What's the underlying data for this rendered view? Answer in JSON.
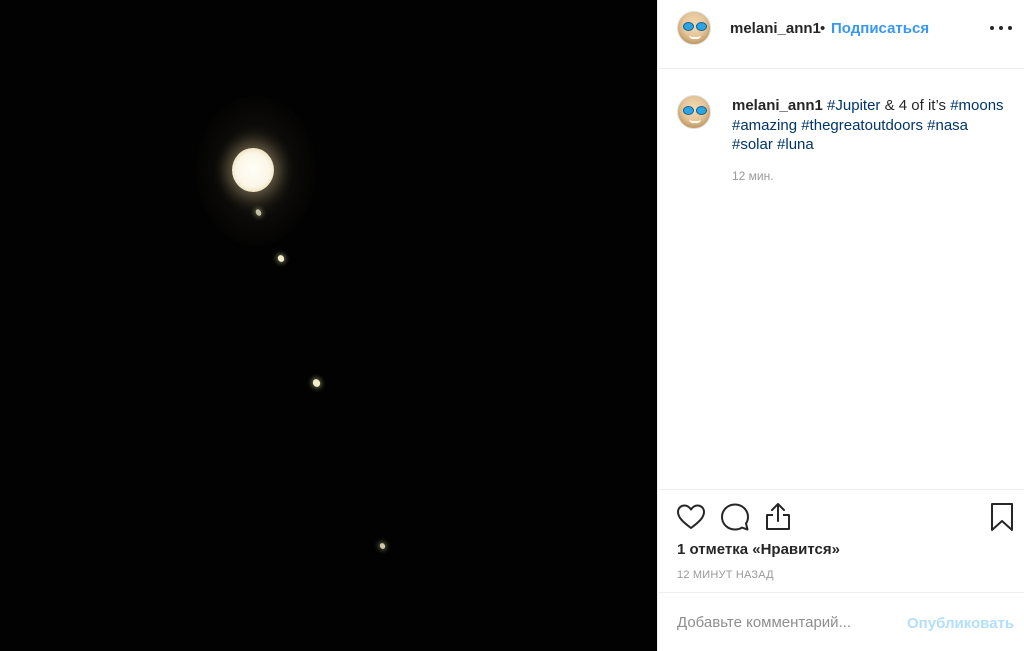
{
  "post": {
    "username": "melani_ann1",
    "separator": "•",
    "follow_label": "Подписаться",
    "more_icon": "more-horizontal-icon"
  },
  "caption": {
    "username": "melani_ann1",
    "text_1": " ",
    "tag_jupiter": "#Jupiter",
    "text_2": " & 4 of it’s ",
    "tag_moons": "#moons",
    "tag_amazing": "#amazing",
    "tag_outdoors": "#thegreatoutdoors",
    "tag_nasa": "#nasa",
    "tag_solar": "#solar",
    "tag_luna": "#luna",
    "time": "12 мин."
  },
  "actions": {
    "like_icon": "heart-icon",
    "comment_icon": "comment-bubble-icon",
    "share_icon": "share-icon",
    "save_icon": "bookmark-icon",
    "likes_text": "1 отметка «Нравится»",
    "posted_ago": "12 минут назад"
  },
  "comment_box": {
    "placeholder": "Добавьте комментарий...",
    "publish_label": "Опубликовать"
  },
  "colors": {
    "link_blue": "#3897f0",
    "hashtag": "#003569",
    "publish_disabled": "#b2dffc",
    "photo_bg": "#020202"
  }
}
